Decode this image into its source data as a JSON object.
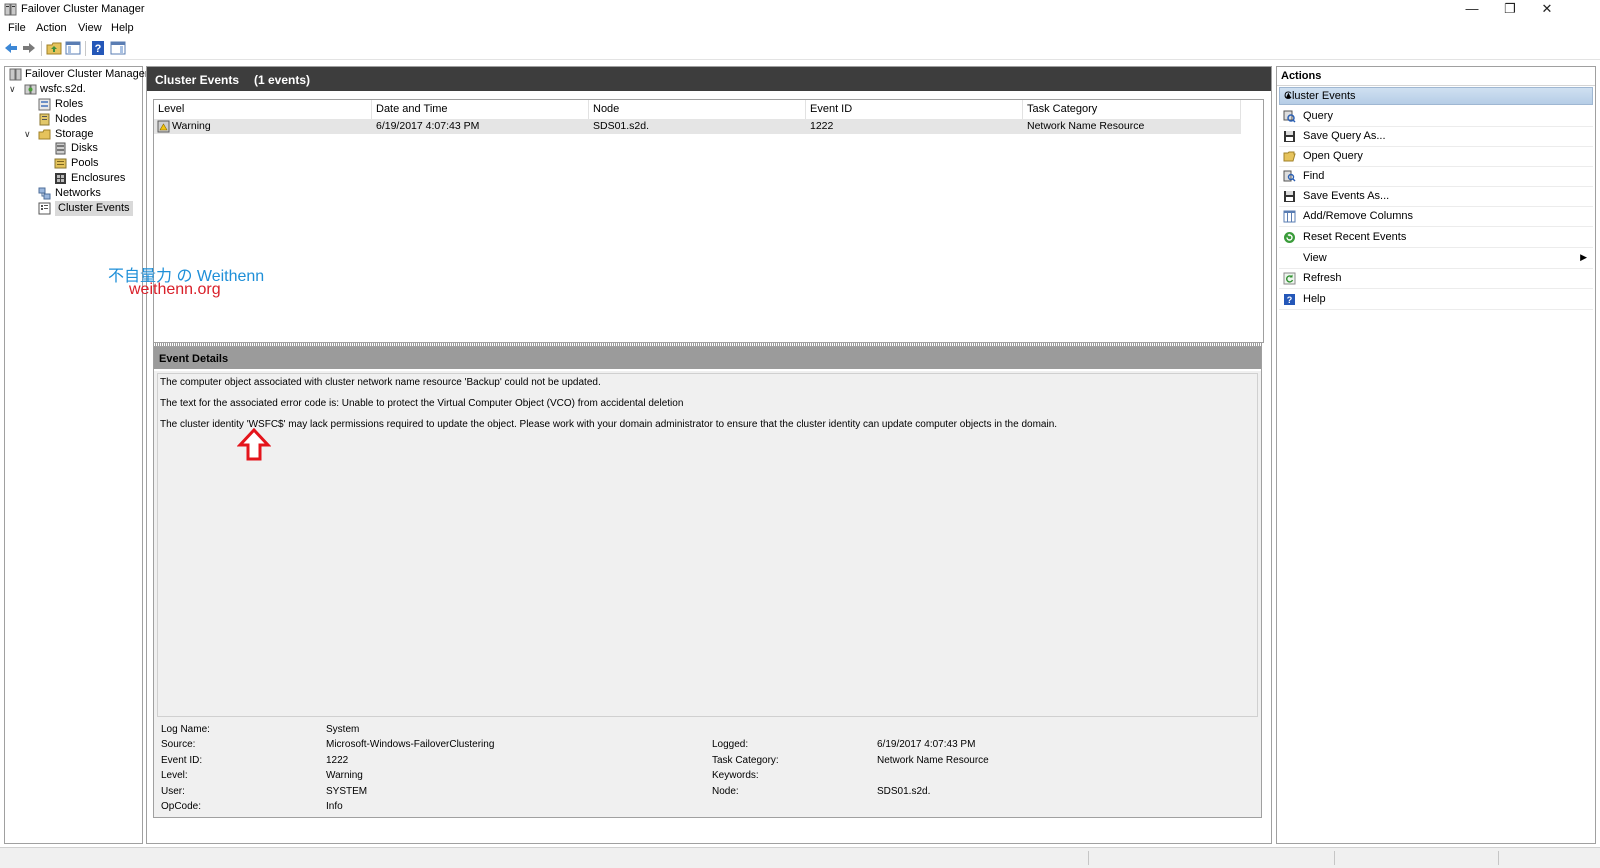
{
  "window": {
    "title": "Failover Cluster Manager",
    "minimize": "—",
    "restore": "❐",
    "close": "✕"
  },
  "menu": [
    "File",
    "Action",
    "View",
    "Help"
  ],
  "toolbar": [
    "back-icon",
    "forward-icon",
    "up-folder-icon",
    "show-hide-tree-icon",
    "help-icon",
    "show-hide-action-pane-icon"
  ],
  "tree": {
    "root": "Failover Cluster Manager",
    "cluster": "wsfc.s2d.",
    "roles": "Roles",
    "nodes": "Nodes",
    "storage": "Storage",
    "disks": "Disks",
    "pools": "Pools",
    "enclosures": "Enclosures",
    "networks": "Networks",
    "cluster_events": "Cluster Events"
  },
  "center": {
    "title": "Cluster Events",
    "count": "(1 events)",
    "columns": [
      "Level",
      "Date and Time",
      "Node",
      "Event ID",
      "Task Category"
    ],
    "rows": [
      {
        "level": "Warning",
        "datetime": "6/19/2017 4:07:43 PM",
        "node": "SDS01.s2d.",
        "event_id": "1222",
        "task_category": "Network Name Resource"
      }
    ]
  },
  "details": {
    "title": "Event Details",
    "lines": [
      "The computer object associated with cluster network name resource 'Backup' could not be updated.",
      "The text for the associated error code is: Unable to protect the Virtual Computer Object (VCO) from accidental deletion",
      "The cluster identity 'WSFC$' may lack permissions required to update the object. Please work with your domain administrator to ensure that the cluster identity can update computer objects in the domain."
    ],
    "props": {
      "log_name_label": "Log Name:",
      "log_name": "System",
      "source_label": "Source:",
      "source": "Microsoft-Windows-FailoverClustering",
      "event_id_label": "Event ID:",
      "event_id": "1222",
      "level_label": "Level:",
      "level": "Warning",
      "user_label": "User:",
      "user": "SYSTEM",
      "opcode_label": "OpCode:",
      "opcode": "Info",
      "logged_label": "Logged:",
      "logged": "6/19/2017 4:07:43 PM",
      "task_category_label": "Task Category:",
      "task_category": "Network Name Resource",
      "keywords_label": "Keywords:",
      "keywords": "",
      "node_label": "Node:",
      "node": "SDS01.s2d."
    }
  },
  "watermark": {
    "line1": "不自量力 の Weithenn",
    "line2": "weithenn.org"
  },
  "actions": {
    "title": "Actions",
    "section": "Cluster Events",
    "items": [
      {
        "label": "Query",
        "icon": "query-icon"
      },
      {
        "label": "Save Query As...",
        "icon": "save-icon"
      },
      {
        "label": "Open Query",
        "icon": "open-folder-icon"
      },
      {
        "label": "Find",
        "icon": "find-icon"
      },
      {
        "label": "Save Events As...",
        "icon": "save-icon"
      },
      {
        "label": "Add/Remove Columns",
        "icon": "columns-icon"
      },
      {
        "label": "Reset Recent Events",
        "icon": "reset-icon"
      },
      {
        "label": "View",
        "icon": ""
      },
      {
        "label": "Refresh",
        "icon": "refresh-icon"
      },
      {
        "label": "Help",
        "icon": "help-icon"
      }
    ]
  },
  "colors": {
    "header_dark": "#3d3d3d",
    "selection": "#d9d9d9",
    "details_header": "#9b9b9b",
    "arrow": "#e4141b",
    "watermark_blue": "#1e8fd8",
    "watermark_red": "#d9202a"
  }
}
